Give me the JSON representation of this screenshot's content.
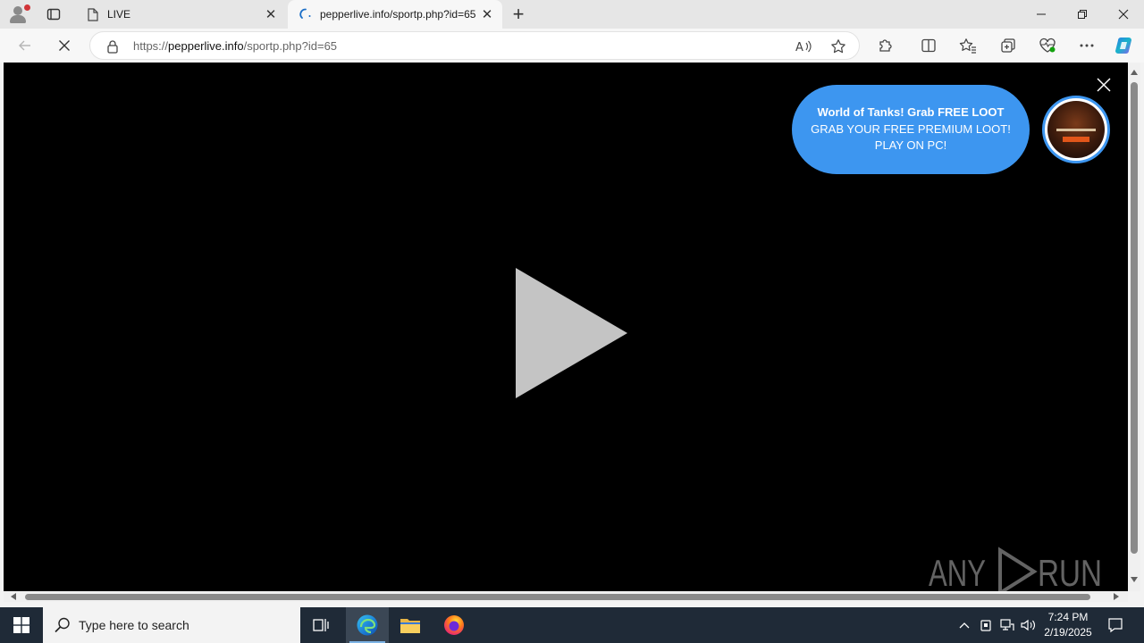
{
  "tabs": [
    {
      "title": "LIVE",
      "active": false
    },
    {
      "title": "pepperlive.info/sportp.php?id=65",
      "active": true
    }
  ],
  "address_bar": {
    "scheme": "https://",
    "host": "pepperlive.info",
    "path": "/sportp.php?id=65"
  },
  "promo": {
    "title": "World of Tanks! Grab FREE LOOT",
    "text": "GRAB YOUR FREE PREMIUM LOOT! PLAY ON PC!"
  },
  "watermark": {
    "left": "ANY",
    "right": "RUN"
  },
  "taskbar": {
    "search_placeholder": "Type here to search",
    "time": "7:24 PM",
    "date": "2/19/2025"
  },
  "colors": {
    "promo_bg": "#3d96f0",
    "taskbar_bg": "#1f2a37",
    "viewport_bg": "#000000",
    "play_icon": "#c4c4c4"
  },
  "icons": {
    "profile": "profile-icon",
    "tab_actions": "tab-actions-icon",
    "page": "page-icon",
    "loading": "loading-icon",
    "stop": "stop-icon",
    "lock": "lock-icon",
    "read_aloud": "read-aloud-icon",
    "favorite": "star-icon",
    "extensions": "puzzle-icon",
    "split_screen": "split-screen-icon",
    "favorites": "favorites-icon",
    "collections": "collections-icon",
    "browser_essentials": "heart-pulse-icon",
    "more": "more-icon",
    "copilot": "copilot-icon"
  }
}
